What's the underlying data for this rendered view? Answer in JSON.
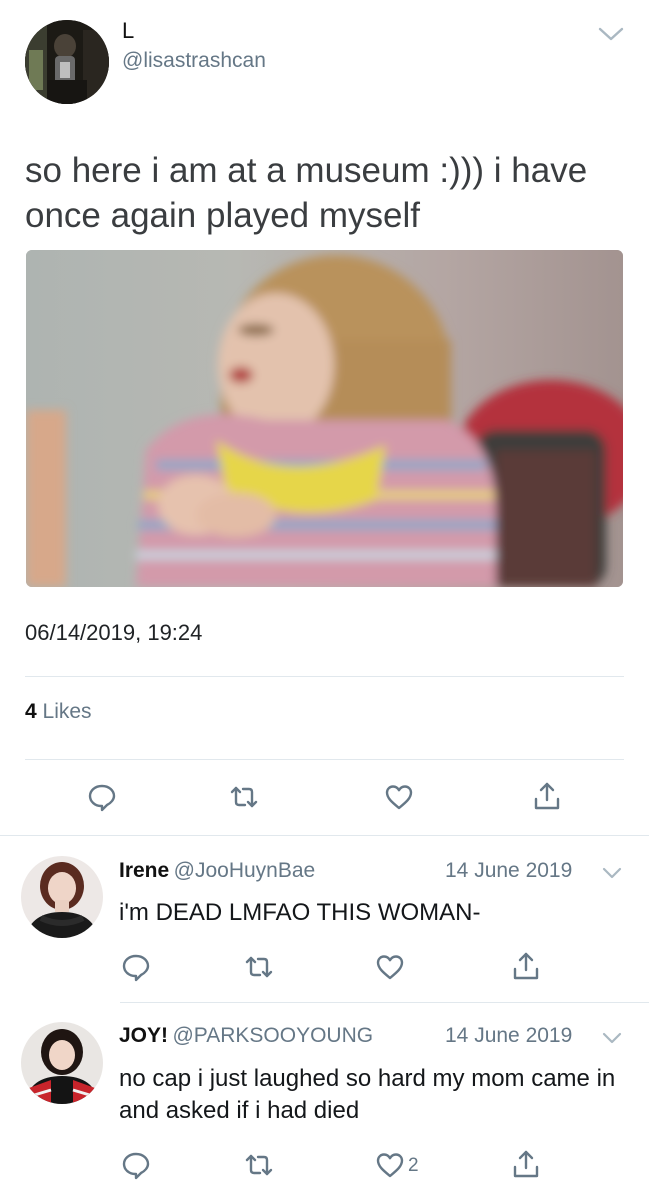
{
  "tweet": {
    "display_name": "L",
    "handle": "@lisastrashcan",
    "text": "so here i am at a museum :))) i have once again played myself",
    "timestamp": "06/14/2019, 19:24",
    "likes_count": "4",
    "likes_label": "Likes"
  },
  "replies": [
    {
      "name": "Irene",
      "handle": "@JooHuynBae",
      "date": "14 June 2019",
      "text": "i'm DEAD LMFAO THIS WOMAN-",
      "like_count": ""
    },
    {
      "name": "JOY!",
      "handle": "@PARKSOOYOUNG",
      "date": "14 June 2019",
      "text": "no cap i just laughed so hard my mom came in and asked if i had died",
      "like_count": "2"
    }
  ],
  "icons": {
    "reply": "reply-icon",
    "retweet": "retweet-icon",
    "like": "heart-icon",
    "share": "share-icon",
    "menu": "chevron-down-icon"
  },
  "colors": {
    "secondary_text": "#657786",
    "divider": "#e1e8ed",
    "icon": "#657786"
  }
}
